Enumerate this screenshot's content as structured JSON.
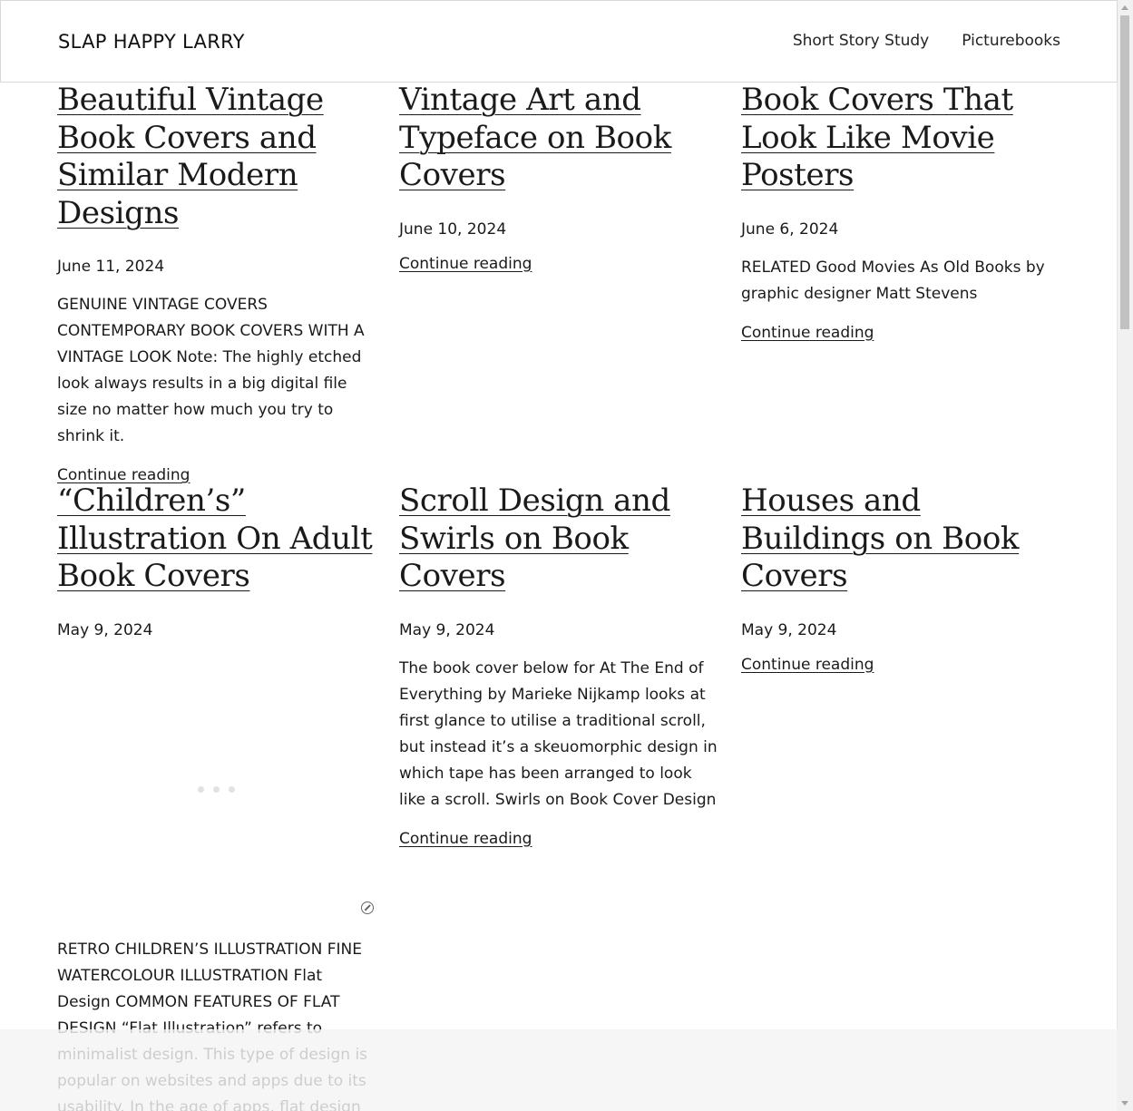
{
  "site": {
    "title": "SLAP HAPPY LARRY"
  },
  "nav": {
    "items": [
      {
        "label": "Short Story Study"
      },
      {
        "label": "Picturebooks"
      }
    ]
  },
  "posts": [
    {
      "title": "Beautiful Vintage Book Covers and Similar Modern Designs",
      "date": "June 11, 2024",
      "excerpt": "GENUINE VINTAGE COVERS CONTEMPORARY BOOK COVERS WITH A VINTAGE LOOK Note: The highly etched look always results in a big digital file size no matter how much you try to shrink it.",
      "more": "Continue reading"
    },
    {
      "title": "Vintage Art and Typeface on Book Covers",
      "date": "June 10, 2024",
      "excerpt": "",
      "more": "Continue reading"
    },
    {
      "title": "Book Covers That Look Like Movie Posters",
      "date": "June 6, 2024",
      "excerpt": "RELATED Good Movies As Old Books by graphic designer Matt Stevens",
      "more": "Continue reading"
    },
    {
      "title": "“Children’s” Illustration On Adult Book Covers",
      "date": "May 9, 2024",
      "excerpt": "RETRO CHILDREN’S ILLUSTRATION FINE WATERCOLOUR ILLUSTRATION Flat Design COMMON FEATURES OF FLAT DESIGN “Flat Illustration” refers to minimalist design. This type of design is popular on websites and apps due to its usability. In the age of apps, flat design has recently been in fashion. This",
      "more": ""
    },
    {
      "title": "Scroll Design and Swirls on Book Covers",
      "date": "May 9, 2024",
      "excerpt": "The book cover below for At The End of Everything by Marieke Nijkamp looks at first glance to utilise a traditional scroll, but instead it’s a skeuomorphic design in which tape has been arranged to look like a scroll. Swirls on Book Cover Design",
      "more": "Continue reading"
    },
    {
      "title": "Houses and Buildings on Book Covers",
      "date": "May 9, 2024",
      "excerpt": "",
      "more": "Continue reading"
    }
  ]
}
